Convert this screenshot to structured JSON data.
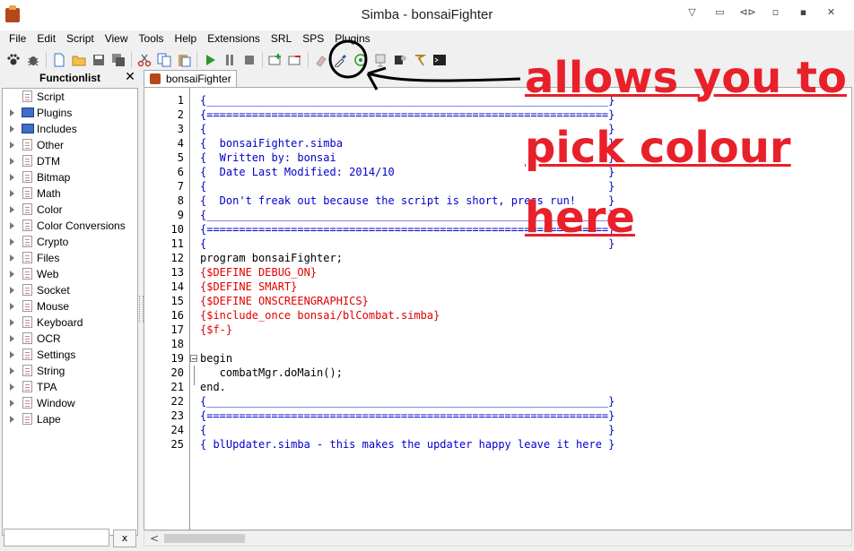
{
  "window": {
    "title": "Simba - bonsaiFighter",
    "controls": [
      "▽",
      "▭",
      "⊲⊳",
      "▫",
      "▪",
      "✕"
    ]
  },
  "menu": [
    "File",
    "Edit",
    "Script",
    "View",
    "Tools",
    "Help",
    "Extensions",
    "SRL",
    "SPS",
    "Plugins"
  ],
  "functionlist": {
    "title": "Functionlist",
    "close": "✕",
    "items": [
      "Script",
      "Plugins",
      "Includes",
      "Other",
      "DTM",
      "Bitmap",
      "Math",
      "Color",
      "Color Conversions",
      "Crypto",
      "Files",
      "Web",
      "Socket",
      "Mouse",
      "Keyboard",
      "OCR",
      "Settings",
      "String",
      "TPA",
      "Window",
      "Lape"
    ],
    "search_clear": "x"
  },
  "tab": {
    "label": "bonsaiFighter"
  },
  "editor": {
    "lines": [
      {
        "n": "1",
        "text": "{______________________________________________________________}",
        "c": "blue"
      },
      {
        "n": "2",
        "text": "{==============================================================}",
        "c": "blue"
      },
      {
        "n": "3",
        "text": "{                                                              }",
        "c": "blue"
      },
      {
        "n": "4",
        "text": "{  bonsaiFighter.simba                                         }",
        "c": "blue"
      },
      {
        "n": "5",
        "text": "{  Written by: bonsai                                          }",
        "c": "blue"
      },
      {
        "n": "6",
        "text": "{  Date Last Modified: 2014/10                                 }",
        "c": "blue"
      },
      {
        "n": "7",
        "text": "{                                                              }",
        "c": "blue"
      },
      {
        "n": "8",
        "text": "{  Don't freak out because the script is short, press run!     }",
        "c": "blue"
      },
      {
        "n": "9",
        "text": "{______________________________________________________________}",
        "c": "blue"
      },
      {
        "n": "10",
        "text": "{==============================================================}",
        "c": "blue"
      },
      {
        "n": "11",
        "text": "{                                                              }",
        "c": "blue"
      },
      {
        "n": "12",
        "text": "program bonsaiFighter;",
        "c": "black"
      },
      {
        "n": "13",
        "text": "{$DEFINE DEBUG_ON}",
        "c": "red"
      },
      {
        "n": "14",
        "text": "{$DEFINE SMART}",
        "c": "red"
      },
      {
        "n": "15",
        "text": "{$DEFINE ONSCREENGRAPHICS}",
        "c": "red"
      },
      {
        "n": "16",
        "text": "{$include_once bonsai/blCombat.simba}",
        "c": "red"
      },
      {
        "n": "17",
        "text": "{$f-}",
        "c": "red"
      },
      {
        "n": "18",
        "text": "",
        "c": "black"
      },
      {
        "n": "19",
        "text": "begin",
        "c": "black"
      },
      {
        "n": "20",
        "text": "   combatMgr.doMain();",
        "c": "black"
      },
      {
        "n": "21",
        "text": "end.",
        "c": "black"
      },
      {
        "n": "22",
        "text": "{______________________________________________________________}",
        "c": "blue"
      },
      {
        "n": "23",
        "text": "{==============================================================}",
        "c": "blue"
      },
      {
        "n": "24",
        "text": "{                                                              }",
        "c": "blue"
      },
      {
        "n": "25",
        "text": "{ blUpdater.simba - this makes the updater happy leave it here }",
        "c": "blue"
      }
    ]
  },
  "annotation": {
    "lines": [
      "allows you to",
      "pick colour",
      "here"
    ],
    "color": "#e8202a"
  },
  "colors": {
    "accent": "#3b6fc9",
    "comment": "#0000cc",
    "directive": "#e00000"
  }
}
